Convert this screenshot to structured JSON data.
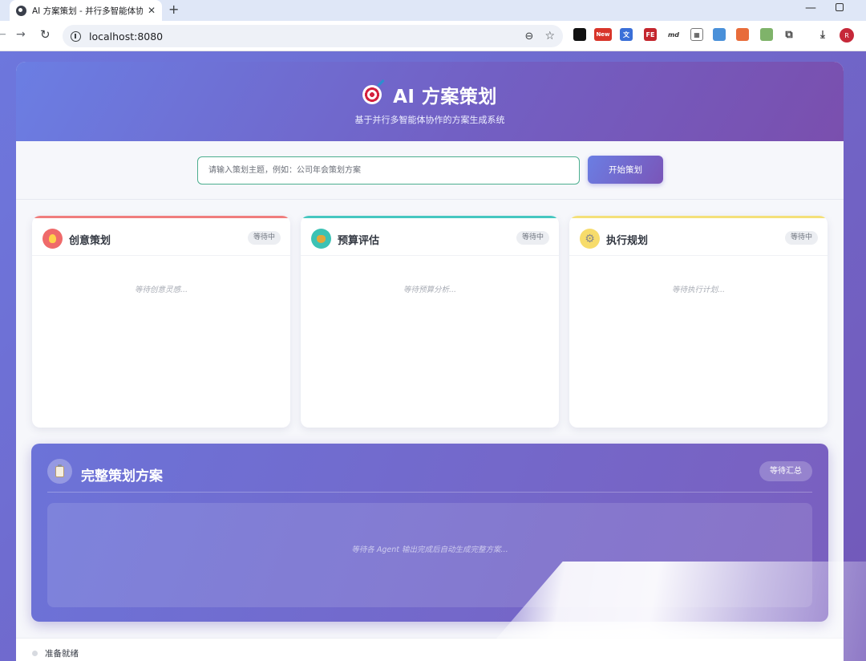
{
  "browser": {
    "tab_title": "AI 方案策划 - 并行多智能体协作",
    "tab_close": "✕",
    "new_tab": "+",
    "url": "localhost:8080",
    "profile_initial": "R",
    "extensions": [
      "new-extension-icon",
      "translate-extension-icon",
      "fe-extension-icon",
      "md-extension-icon",
      "qr-extension-icon",
      "card-extension-icon",
      "puzzle-extensions-icon",
      "download-icon"
    ]
  },
  "header": {
    "icon": "target-icon",
    "title": "AI 方案策划",
    "subtitle": "基于并行多智能体协作的方案生成系统"
  },
  "search": {
    "placeholder": "请输入策划主题，例如：公司年会策划方案",
    "value": "",
    "button_label": "开始策划"
  },
  "agents": [
    {
      "title": "创意策划",
      "status": "等待中",
      "placeholder": "等待创意灵感...",
      "icon": "lightbulb-icon",
      "accent": "#f06a6a"
    },
    {
      "title": "预算评估",
      "status": "等待中",
      "placeholder": "等待预算分析...",
      "icon": "money-bag-icon",
      "accent": "#3fc4bb"
    },
    {
      "title": "执行规划",
      "status": "等待中",
      "placeholder": "等待执行计划...",
      "icon": "gear-icon",
      "accent": "#f5de6a"
    }
  ],
  "final_plan": {
    "icon": "clipboard-icon",
    "title": "完整策划方案",
    "status": "等待汇总",
    "placeholder": "等待各 Agent 输出完成后自动生成完整方案..."
  },
  "status": {
    "text": "准备就绪"
  }
}
